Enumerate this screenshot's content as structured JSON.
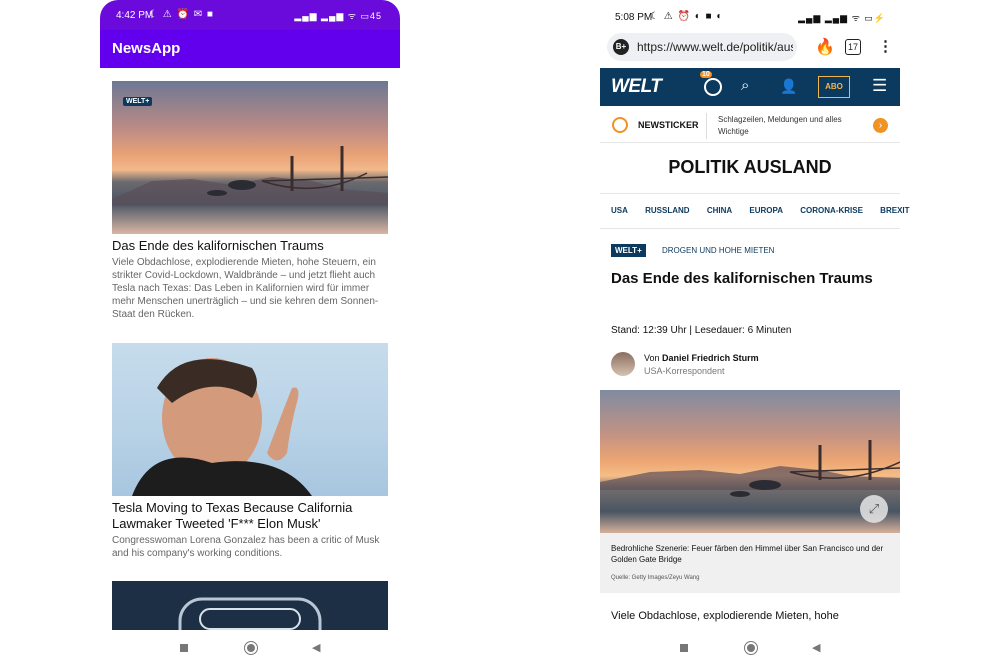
{
  "left_phone": {
    "status": {
      "time": "4:42 PM",
      "battery": "45"
    },
    "app_title": "NewsApp",
    "articles": [
      {
        "badge": "WELT+",
        "title": "Das Ende des kalifornischen Traums",
        "description": "Viele Obdachlose, explodierende Mieten, hohe Steuern, ein strikter Covid-Lockdown, Waldbrände – und jetzt flieht auch Tesla nach Texas: Das Leben in Kalifornien wird für immer mehr Menschen unerträglich – und sie kehren dem Sonnen-Staat den Rücken."
      },
      {
        "title": "Tesla Moving to Texas Because California Lawmaker Tweeted 'F*** Elon Musk'",
        "description": "Congresswoman Lorena Gonzalez has been a critic of Musk and his company's working conditions."
      }
    ]
  },
  "right_phone": {
    "status": {
      "time": "5:08 PM"
    },
    "browser": {
      "url": "https://www.welt.de/politik/ausland",
      "tab_count": "17"
    },
    "header": {
      "logo": "WELT",
      "history_count": "10",
      "abo_label": "ABO"
    },
    "newsticker": {
      "label": "NEWSTICKER",
      "text": "Schlagzeilen, Meldungen und alles Wichtige"
    },
    "section_title": "POLITIK AUSLAND",
    "section_nav": [
      "USA",
      "RUSSLAND",
      "CHINA",
      "EUROPA",
      "CORONA-KRISE",
      "BREXIT"
    ],
    "article": {
      "badge": "WELT+",
      "kicker": "DROGEN UND HOHE MIETEN",
      "headline": "Das Ende des kalifornischen Traums",
      "meta": "Stand: 12:39 Uhr | Lesedauer: 6 Minuten",
      "author_prefix": "Von",
      "author_name": "Daniel Friedrich Sturm",
      "author_role": "USA-Korrespondent",
      "caption": "Bedrohliche Szenerie: Feuer färben den Himmel über San Francisco und der Golden Gate Bridge",
      "source": "Quelle: Getty Images/Zeyu Wang",
      "lead": "Viele Obdachlose, explodierende Mieten, hohe"
    }
  }
}
